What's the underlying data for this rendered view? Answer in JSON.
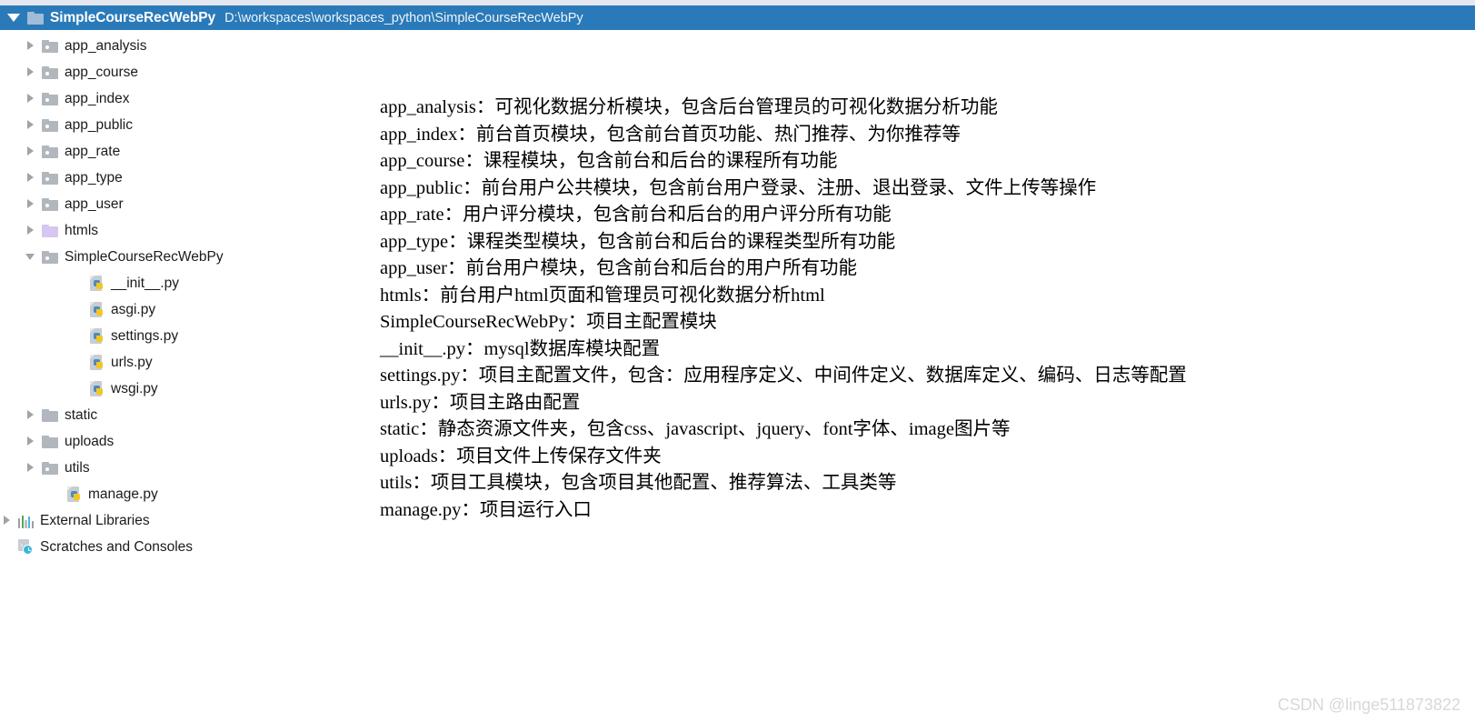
{
  "header": {
    "expander_icon": "triangle-down-icon",
    "folder_icon": "folder-icon",
    "title": "SimpleCourseRecWebPy",
    "path": "D:\\workspaces\\workspaces_python\\SimpleCourseRecWebPy",
    "bar_color": "#2a7ab9",
    "title_color": "#ffffff"
  },
  "tree": {
    "items": [
      {
        "label": "app_analysis",
        "icon": "folder-module-icon",
        "arrow": "collapsed",
        "indent": 1
      },
      {
        "label": "app_course",
        "icon": "folder-module-icon",
        "arrow": "collapsed",
        "indent": 1
      },
      {
        "label": "app_index",
        "icon": "folder-module-icon",
        "arrow": "collapsed",
        "indent": 1
      },
      {
        "label": "app_public",
        "icon": "folder-module-icon",
        "arrow": "collapsed",
        "indent": 1
      },
      {
        "label": "app_rate",
        "icon": "folder-module-icon",
        "arrow": "collapsed",
        "indent": 1
      },
      {
        "label": "app_type",
        "icon": "folder-module-icon",
        "arrow": "collapsed",
        "indent": 1
      },
      {
        "label": "app_user",
        "icon": "folder-module-icon",
        "arrow": "collapsed",
        "indent": 1
      },
      {
        "label": "htmls",
        "icon": "folder-template-icon",
        "arrow": "collapsed",
        "indent": 1
      },
      {
        "label": "SimpleCourseRecWebPy",
        "icon": "folder-module-icon",
        "arrow": "expanded",
        "indent": 1
      },
      {
        "label": "__init__.py",
        "icon": "python-file-icon",
        "arrow": "none",
        "indent": 3
      },
      {
        "label": "asgi.py",
        "icon": "python-file-icon",
        "arrow": "none",
        "indent": 3
      },
      {
        "label": "settings.py",
        "icon": "python-file-icon",
        "arrow": "none",
        "indent": 3
      },
      {
        "label": "urls.py",
        "icon": "python-file-icon",
        "arrow": "none",
        "indent": 3
      },
      {
        "label": "wsgi.py",
        "icon": "python-file-icon",
        "arrow": "none",
        "indent": 3
      },
      {
        "label": "static",
        "icon": "folder-icon",
        "arrow": "collapsed",
        "indent": 1
      },
      {
        "label": "uploads",
        "icon": "folder-icon",
        "arrow": "collapsed",
        "indent": 1
      },
      {
        "label": "utils",
        "icon": "folder-module-icon",
        "arrow": "collapsed",
        "indent": 1
      },
      {
        "label": "manage.py",
        "icon": "python-file-icon",
        "arrow": "none",
        "indent": 2
      },
      {
        "label": "External Libraries",
        "icon": "libraries-icon",
        "arrow": "collapsed",
        "indent": 0
      },
      {
        "label": "Scratches and Consoles",
        "icon": "scratches-icon",
        "arrow": "none",
        "indent": 0
      }
    ]
  },
  "description": {
    "lines": [
      {
        "name": "app_analysis",
        "text": "app_analysis：可视化数据分析模块，包含后台管理员的可视化数据分析功能"
      },
      {
        "name": "app_index",
        "text": "app_index：前台首页模块，包含前台首页功能、热门推荐、为你推荐等"
      },
      {
        "name": "app_course",
        "text": "app_course：课程模块，包含前台和后台的课程所有功能"
      },
      {
        "name": "app_public",
        "text": "app_public：前台用户公共模块，包含前台用户登录、注册、退出登录、文件上传等操作"
      },
      {
        "name": "app_rate",
        "text": "app_rate：用户评分模块，包含前台和后台的用户评分所有功能"
      },
      {
        "name": "app_type",
        "text": "app_type：课程类型模块，包含前台和后台的课程类型所有功能"
      },
      {
        "name": "app_user",
        "text": "app_user：前台用户模块，包含前台和后台的用户所有功能"
      },
      {
        "name": "htmls",
        "text": "htmls：前台用户html页面和管理员可视化数据分析html"
      },
      {
        "name": "SimpleCourseRecWebPy",
        "text": "SimpleCourseRecWebPy：项目主配置模块"
      },
      {
        "name": "__init__.py",
        "text": "__init__.py：mysql数据库模块配置"
      },
      {
        "name": "settings.py",
        "text": "settings.py：项目主配置文件，包含：应用程序定义、中间件定义、数据库定义、编码、日志等配置"
      },
      {
        "name": "urls.py",
        "text": "urls.py：项目主路由配置"
      },
      {
        "name": "static",
        "text": "static：静态资源文件夹，包含css、javascript、jquery、font字体、image图片等"
      },
      {
        "name": "uploads",
        "text": "uploads：项目文件上传保存文件夹"
      },
      {
        "name": "utils",
        "text": "utils：项目工具模块，包含项目其他配置、推荐算法、工具类等"
      },
      {
        "name": "manage.py",
        "text": "manage.py：项目运行入口"
      }
    ]
  },
  "watermark": {
    "text": "CSDN @linge511873822",
    "color": "#d8d8d8"
  }
}
